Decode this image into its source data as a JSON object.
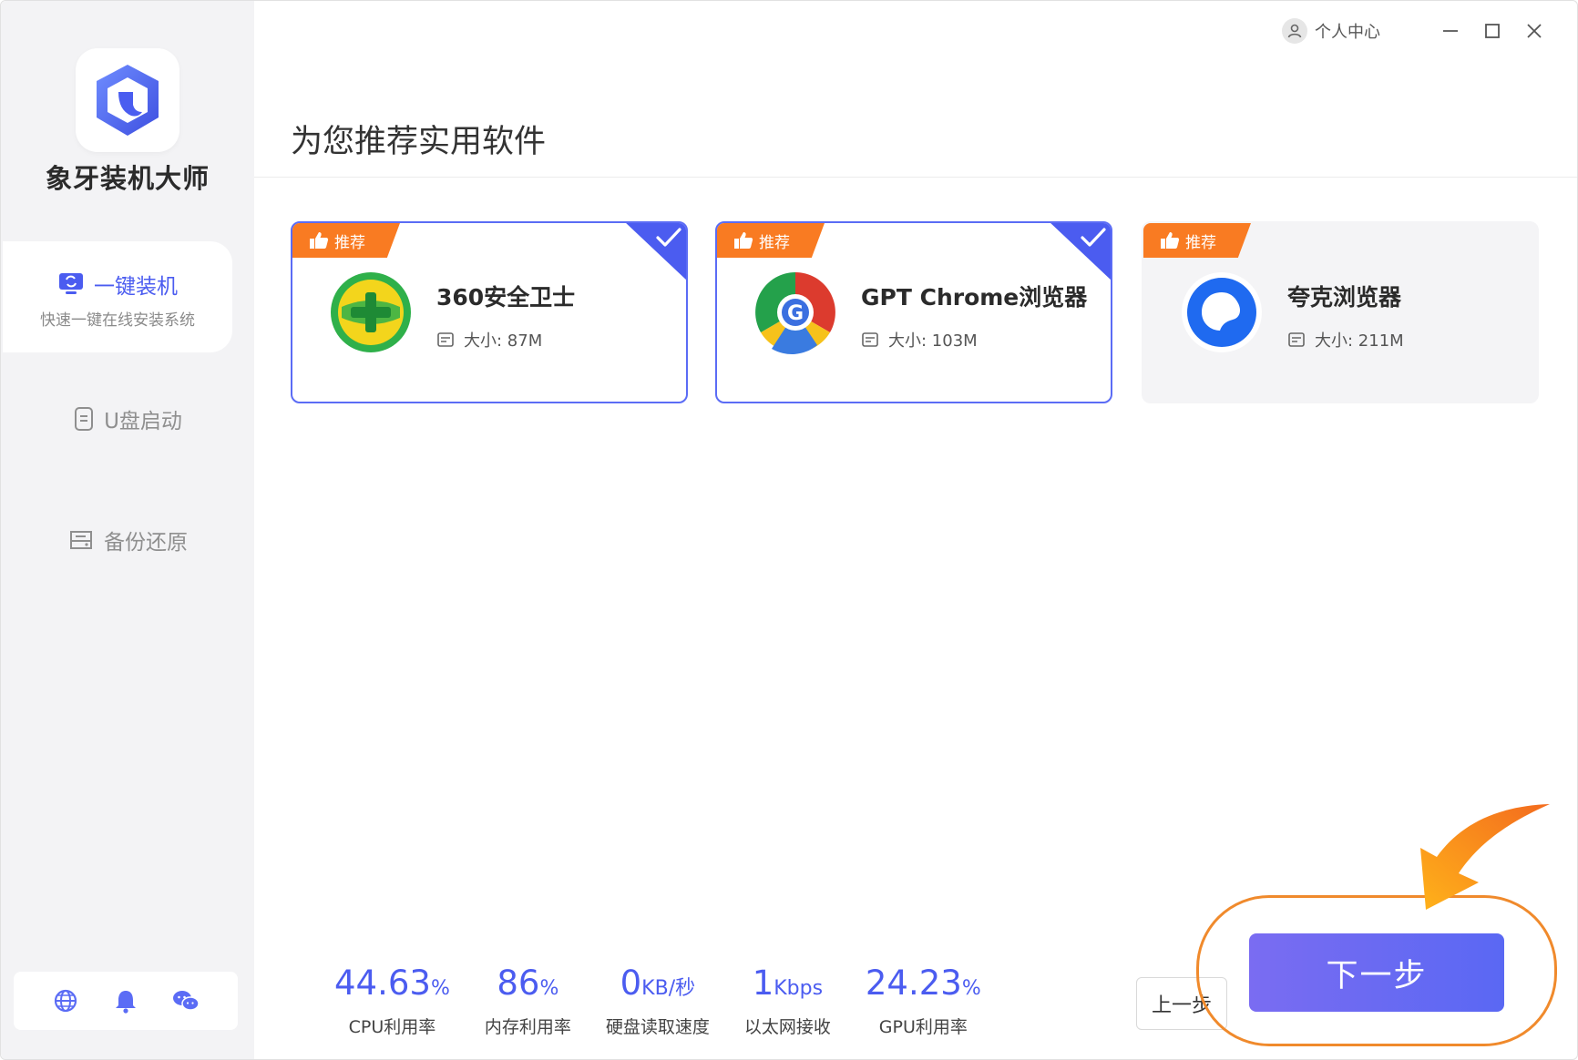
{
  "app": {
    "name": "象牙装机大师"
  },
  "titlebar": {
    "user_center": "个人中心"
  },
  "sidebar": {
    "items": [
      {
        "label": "一键装机",
        "sub": "快速一键在线安装系统",
        "active": true
      },
      {
        "label": "U盘启动",
        "active": false
      },
      {
        "label": "备份还原",
        "active": false
      }
    ],
    "bottom_icons": [
      "globe-icon",
      "bell-icon",
      "wechat-icon"
    ]
  },
  "main": {
    "title": "为您推荐实用软件",
    "badge_label": "推荐",
    "size_prefix": "大小: ",
    "cards": [
      {
        "name": "360安全卫士",
        "size": "大小: 87M",
        "selected": true,
        "icon": "360-security-icon"
      },
      {
        "name": "GPT Chrome浏览器",
        "size": "大小: 103M",
        "selected": true,
        "icon": "chrome-browser-icon"
      },
      {
        "name": "夸克浏览器",
        "size": "大小: 211M",
        "selected": false,
        "icon": "quark-browser-icon"
      }
    ]
  },
  "stats": [
    {
      "value": "44.63",
      "unit": "%",
      "label": "CPU利用率"
    },
    {
      "value": "86",
      "unit": "%",
      "label": "内存利用率"
    },
    {
      "value": "0",
      "unit": "KB/秒",
      "label": "硬盘读取速度"
    },
    {
      "value": "1",
      "unit": "Kbps",
      "label": "以太网接收"
    },
    {
      "value": "24.23",
      "unit": "%",
      "label": "GPU利用率"
    }
  ],
  "buttons": {
    "prev": "上一步",
    "next": "下一步"
  },
  "colors": {
    "accent": "#4b5cf0",
    "badge": "#f97b22",
    "highlight": "#f08a2c"
  }
}
